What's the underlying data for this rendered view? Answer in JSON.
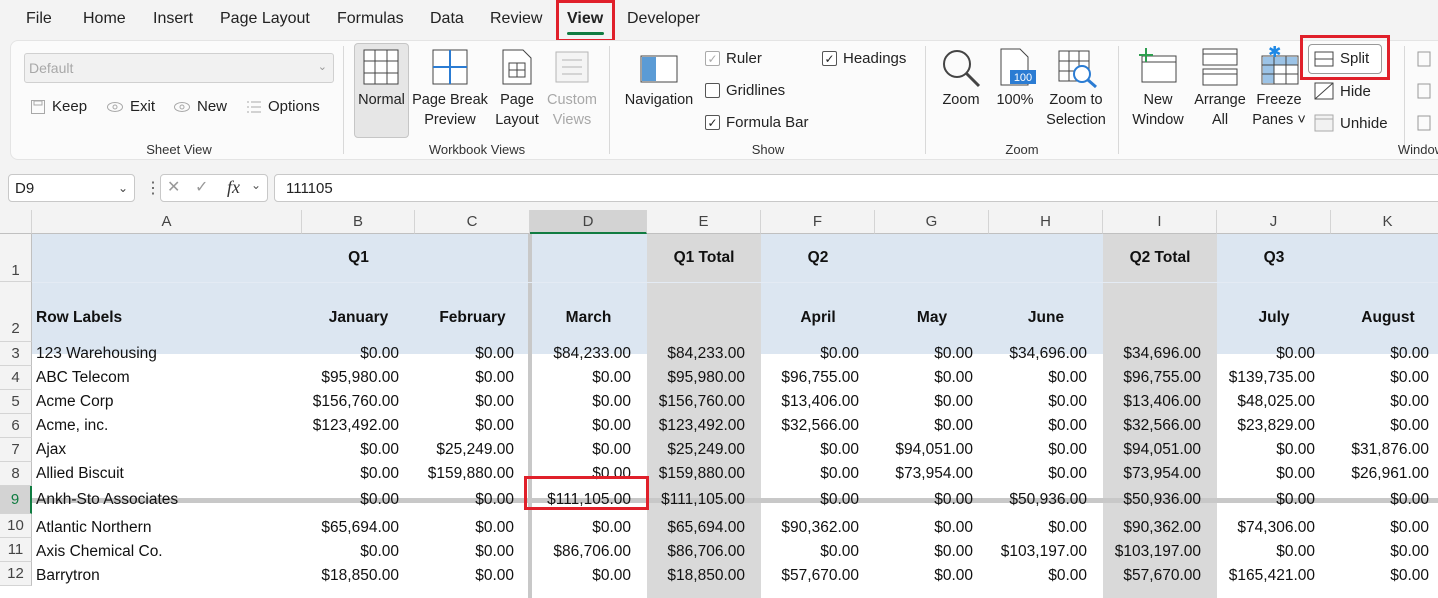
{
  "tabs": [
    "File",
    "Home",
    "Insert",
    "Page Layout",
    "Formulas",
    "Data",
    "Review",
    "View",
    "Developer"
  ],
  "ribbon": {
    "sheet_view": {
      "dropdown_value": "Default",
      "keep": "Keep",
      "exit": "Exit",
      "new": "New",
      "options": "Options",
      "label": "Sheet View"
    },
    "workbook_views": {
      "normal": "Normal",
      "page_break_1": "Page Break",
      "page_break_2": "Preview",
      "page_layout_1": "Page",
      "page_layout_2": "Layout",
      "custom_1": "Custom",
      "custom_2": "Views",
      "label": "Workbook Views"
    },
    "show": {
      "navigation": "Navigation",
      "ruler": "Ruler",
      "gridlines": "Gridlines",
      "formula_bar": "Formula Bar",
      "headings": "Headings",
      "label": "Show"
    },
    "zoom": {
      "zoom": "Zoom",
      "hundred": "100%",
      "hundred_badge": "100",
      "zoom_sel_1": "Zoom to",
      "zoom_sel_2": "Selection",
      "label": "Zoom"
    },
    "window": {
      "new_1": "New",
      "new_2": "Window",
      "arrange_1": "Arrange",
      "arrange_2": "All",
      "freeze_1": "Freeze",
      "freeze_2": "Panes ˅",
      "split": "Split",
      "hide": "Hide",
      "unhide": "Unhide",
      "label": "Window"
    }
  },
  "formula_bar": {
    "name_box": "D9",
    "formula": "111105",
    "fx": "fx"
  },
  "sheet": {
    "columns": [
      "A",
      "B",
      "C",
      "D",
      "E",
      "F",
      "G",
      "H",
      "I",
      "J",
      "K"
    ],
    "header_row1": [
      "",
      "Q1",
      "",
      "",
      "Q1 Total",
      "Q2",
      "",
      "",
      "Q2 Total",
      "Q3",
      ""
    ],
    "header_row2": [
      "Row Labels",
      "January",
      "February",
      "March",
      "",
      "April",
      "May",
      "June",
      "",
      "July",
      "August"
    ],
    "rows": [
      {
        "n": "3",
        "cells": [
          "123 Warehousing",
          "$0.00",
          "$0.00",
          "$84,233.00",
          "$84,233.00",
          "$0.00",
          "$0.00",
          "$34,696.00",
          "$34,696.00",
          "$0.00",
          "$0.00"
        ]
      },
      {
        "n": "4",
        "cells": [
          "ABC Telecom",
          "$95,980.00",
          "$0.00",
          "$0.00",
          "$95,980.00",
          "$96,755.00",
          "$0.00",
          "$0.00",
          "$96,755.00",
          "$139,735.00",
          "$0.00"
        ]
      },
      {
        "n": "5",
        "cells": [
          "Acme Corp",
          "$156,760.00",
          "$0.00",
          "$0.00",
          "$156,760.00",
          "$13,406.00",
          "$0.00",
          "$0.00",
          "$13,406.00",
          "$48,025.00",
          "$0.00"
        ]
      },
      {
        "n": "6",
        "cells": [
          "Acme, inc.",
          "$123,492.00",
          "$0.00",
          "$0.00",
          "$123,492.00",
          "$32,566.00",
          "$0.00",
          "$0.00",
          "$32,566.00",
          "$23,829.00",
          "$0.00"
        ]
      },
      {
        "n": "7",
        "cells": [
          "Ajax",
          "$0.00",
          "$25,249.00",
          "$0.00",
          "$25,249.00",
          "$0.00",
          "$94,051.00",
          "$0.00",
          "$94,051.00",
          "$0.00",
          "$31,876.00"
        ]
      },
      {
        "n": "8",
        "cells": [
          "Allied Biscuit",
          "$0.00",
          "$159,880.00",
          "$0.00",
          "$159,880.00",
          "$0.00",
          "$73,954.00",
          "$0.00",
          "$73,954.00",
          "$0.00",
          "$26,961.00"
        ]
      },
      {
        "n": "9",
        "cells": [
          "Ankh-Sto Associates",
          "$0.00",
          "$0.00",
          "$111,105.00",
          "$111,105.00",
          "$0.00",
          "$0.00",
          "$50,936.00",
          "$50,936.00",
          "$0.00",
          "$0.00"
        ]
      },
      {
        "n": "10",
        "cells": [
          "Atlantic Northern",
          "$65,694.00",
          "$0.00",
          "$0.00",
          "$65,694.00",
          "$90,362.00",
          "$0.00",
          "$0.00",
          "$90,362.00",
          "$74,306.00",
          "$0.00"
        ]
      },
      {
        "n": "11",
        "cells": [
          "Axis Chemical Co.",
          "$0.00",
          "$0.00",
          "$86,706.00",
          "$86,706.00",
          "$0.00",
          "$0.00",
          "$103,197.00",
          "$103,197.00",
          "$0.00",
          "$0.00"
        ]
      },
      {
        "n": "12",
        "cells": [
          "Barrytron",
          "$18,850.00",
          "$0.00",
          "$0.00",
          "$18,850.00",
          "$57,670.00",
          "$0.00",
          "$0.00",
          "$57,670.00",
          "$165,421.00",
          "$0.00"
        ]
      }
    ],
    "selected_column": "D",
    "selected_row": "9"
  },
  "colors": {
    "accent": "#107c41",
    "highlight": "#e0202a",
    "header_fill": "#dce6f1",
    "total_fill": "#d9d9d9"
  }
}
